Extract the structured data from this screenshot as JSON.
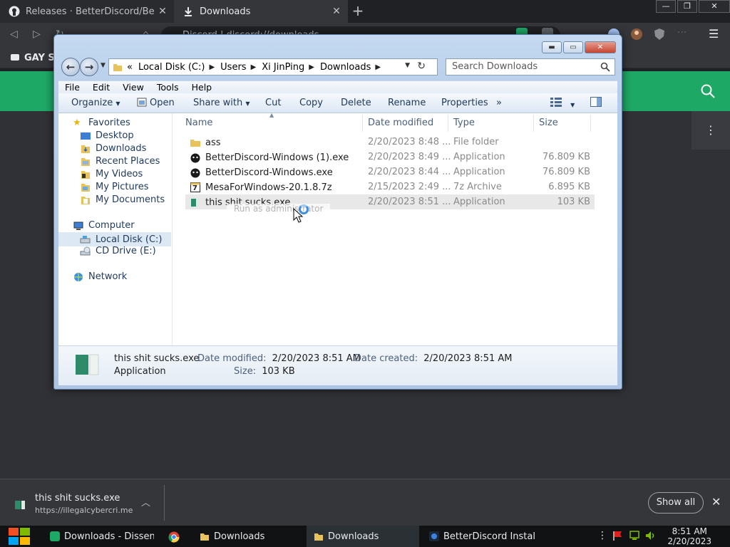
{
  "chrome": {
    "tabs": [
      {
        "title": "Releases · BetterDiscord/Bette",
        "icon": "github-icon"
      },
      {
        "title": "Downloads",
        "icon": "download-icon"
      }
    ],
    "new_tab": "+",
    "omnibox_text": "Discord | discord://downloads",
    "bookmark": "GAY S"
  },
  "explorer": {
    "address": [
      "Local Disk (C:)",
      "Users",
      "Xi JinPing",
      "Downloads"
    ],
    "address_prefix": "«",
    "search_placeholder": "Search Downloads",
    "menu": [
      "File",
      "Edit",
      "View",
      "Tools",
      "Help"
    ],
    "commands": {
      "organize": "Organize",
      "open": "Open",
      "share_with": "Share with",
      "cut": "Cut",
      "copy": "Copy",
      "delete": "Delete",
      "rename": "Rename",
      "properties": "Properties",
      "more": "»"
    },
    "nav": {
      "favorites": "Favorites",
      "favorites_items": [
        "Desktop",
        "Downloads",
        "Recent Places",
        "My Videos",
        "My Pictures",
        "My Documents"
      ],
      "computer": "Computer",
      "computer_items": [
        "Local Disk (C:)",
        "CD Drive (E:)"
      ],
      "network": "Network"
    },
    "columns": {
      "name": "Name",
      "date": "Date modified",
      "type": "Type",
      "size": "Size"
    },
    "files": [
      {
        "name": "ass",
        "date": "2/20/2023 8:48 ...",
        "type": "File folder",
        "size": ""
      },
      {
        "name": "BetterDiscord-Windows (1).exe",
        "date": "2/20/2023 8:49 ...",
        "type": "Application",
        "size": "76.809 KB"
      },
      {
        "name": "BetterDiscord-Windows.exe",
        "date": "2/20/2023 8:44 ...",
        "type": "Application",
        "size": "76.809 KB"
      },
      {
        "name": "MesaForWindows-20.1.8.7z",
        "date": "2/15/2023 2:49 ...",
        "type": "7z Archive",
        "size": "6.895 KB"
      },
      {
        "name": "this shit sucks.exe",
        "date": "2/20/2023 8:51 ...",
        "type": "Application",
        "size": "103 KB"
      }
    ],
    "ghost_menu": "Run as administrator",
    "details": {
      "name": "this shit sucks.exe",
      "type": "Application",
      "modified_label": "Date modified:",
      "modified": "2/20/2023 8:51 AM",
      "created_label": "Date created:",
      "created": "2/20/2023 8:51 AM",
      "size_label": "Size:",
      "size": "103 KB"
    }
  },
  "download_shelf": {
    "file": "this shit sucks.exe",
    "url": "https://illegalcybercri.me",
    "show_all": "Show all"
  },
  "taskbar": {
    "items": [
      "Downloads - Dissen...",
      "",
      "Downloads",
      "Downloads",
      "BetterDiscord Installer"
    ],
    "time": "8:51 AM",
    "date": "2/20/2023"
  },
  "colors": {
    "discord_green": "#1ea866",
    "accent_blue": "#3d8ee3"
  }
}
